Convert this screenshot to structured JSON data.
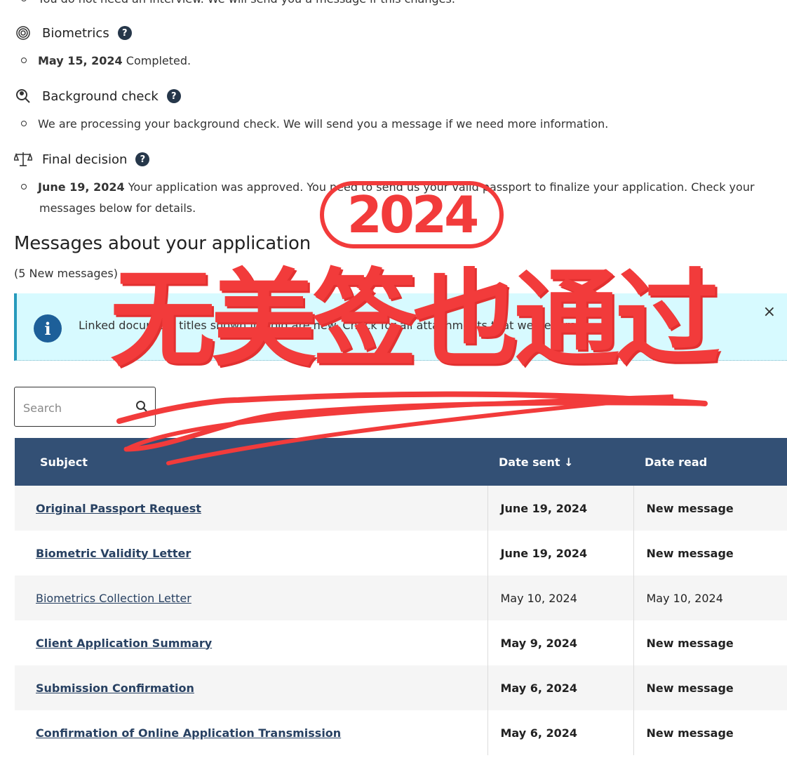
{
  "status": {
    "top_partial_text": "You do not need an interview. We will send you a message if this changes.",
    "biometrics": {
      "heading": "Biometrics",
      "date": "May 15, 2024",
      "text": "Completed."
    },
    "background_check": {
      "heading": "Background check",
      "text": "We are processing your background check. We will send you a message if we need more information."
    },
    "final_decision": {
      "heading": "Final decision",
      "date": "June 19, 2024",
      "text_line1": "Your application was approved. You need to send us your valid passport to finalize your application. Check your",
      "text_line2": "messages below for details."
    },
    "help_glyph": "?"
  },
  "messages": {
    "title": "Messages about your application",
    "new_count": "(5 New messages)",
    "alert_text": "Linked document titles shown in bold are new. Check for all attachments that we generate",
    "close_glyph": "×",
    "info_glyph": "i",
    "search_placeholder": "Search",
    "columns": [
      "Subject",
      "Date sent ↓",
      "Date read"
    ],
    "rows": [
      {
        "subject": "Original Passport Request",
        "sent": "June 19, 2024",
        "read": "New message",
        "unread": true
      },
      {
        "subject": "Biometric Validity Letter",
        "sent": "June 19, 2024",
        "read": "New message",
        "unread": true
      },
      {
        "subject": "Biometrics Collection Letter",
        "sent": "May 10, 2024",
        "read": "May 10, 2024",
        "unread": false
      },
      {
        "subject": "Client Application Summary",
        "sent": "May 9, 2024",
        "read": "New message",
        "unread": true
      },
      {
        "subject": "Submission Confirmation",
        "sent": "May 6, 2024",
        "read": "New message",
        "unread": true
      },
      {
        "subject": "Confirmation of Online Application Transmission",
        "sent": "May 6, 2024",
        "read": "New message",
        "unread": true
      }
    ]
  },
  "overlay": {
    "year": "2024",
    "headline": "无美签也通过",
    "color": "#f23b3b"
  },
  "colors": {
    "table_header": "#335075",
    "link": "#284162",
    "alert_bg": "#d7faff",
    "help_bg": "#26374a"
  },
  "icons": [
    "fingerprint-icon",
    "magnifier-person-icon",
    "scales-icon",
    "help-icon",
    "info-icon",
    "close-icon",
    "search-icon",
    "sort-arrow-icon"
  ]
}
